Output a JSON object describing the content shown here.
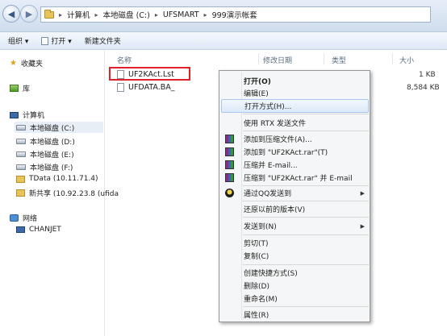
{
  "address": {
    "crumbs": [
      "计算机",
      "本地磁盘 (C:)",
      "UFSMART",
      "999演示帐套"
    ]
  },
  "toolbar": {
    "organize": "组织 ▾",
    "open": "打开 ▾",
    "new_folder": "新建文件夹"
  },
  "sidebar": {
    "favorites": "收藏夹",
    "libraries": "库",
    "computer": "计算机",
    "drives": [
      "本地磁盘 (C:)",
      "本地磁盘 (D:)",
      "本地磁盘 (E:)",
      "本地磁盘 (F:)"
    ],
    "tdata": "TData (10.11.71.4)",
    "share": "新共享 (10.92.23.8 (ufida",
    "network": "网络",
    "chanjet": "CHANJET"
  },
  "columns": {
    "name": "名称",
    "date": "修改日期",
    "type": "类型",
    "size": "大小"
  },
  "files": [
    {
      "name": "UF2KAct.Lst",
      "size": "1 KB"
    },
    {
      "name": "UFDATA.BA_",
      "size": "8,584 KB"
    }
  ],
  "context_menu": {
    "open": "打开(O)",
    "edit": "编辑(E)",
    "open_with": "打开方式(H)...",
    "rtx": "使用 RTX 发送文件",
    "add_archive": "添加到压缩文件(A)...",
    "add_rar": "添加到 \"UF2KAct.rar\"(T)",
    "compress_email": "压缩并 E-mail...",
    "compress_rar_email": "压缩到 \"UF2KAct.rar\" 并 E-mail",
    "qq_send": "通过QQ发送到",
    "restore": "还原以前的版本(V)",
    "send_to": "发送到(N)",
    "cut": "剪切(T)",
    "copy": "复制(C)",
    "shortcut": "创建快捷方式(S)",
    "delete": "删除(D)",
    "rename": "重命名(M)",
    "properties": "属性(R)"
  }
}
